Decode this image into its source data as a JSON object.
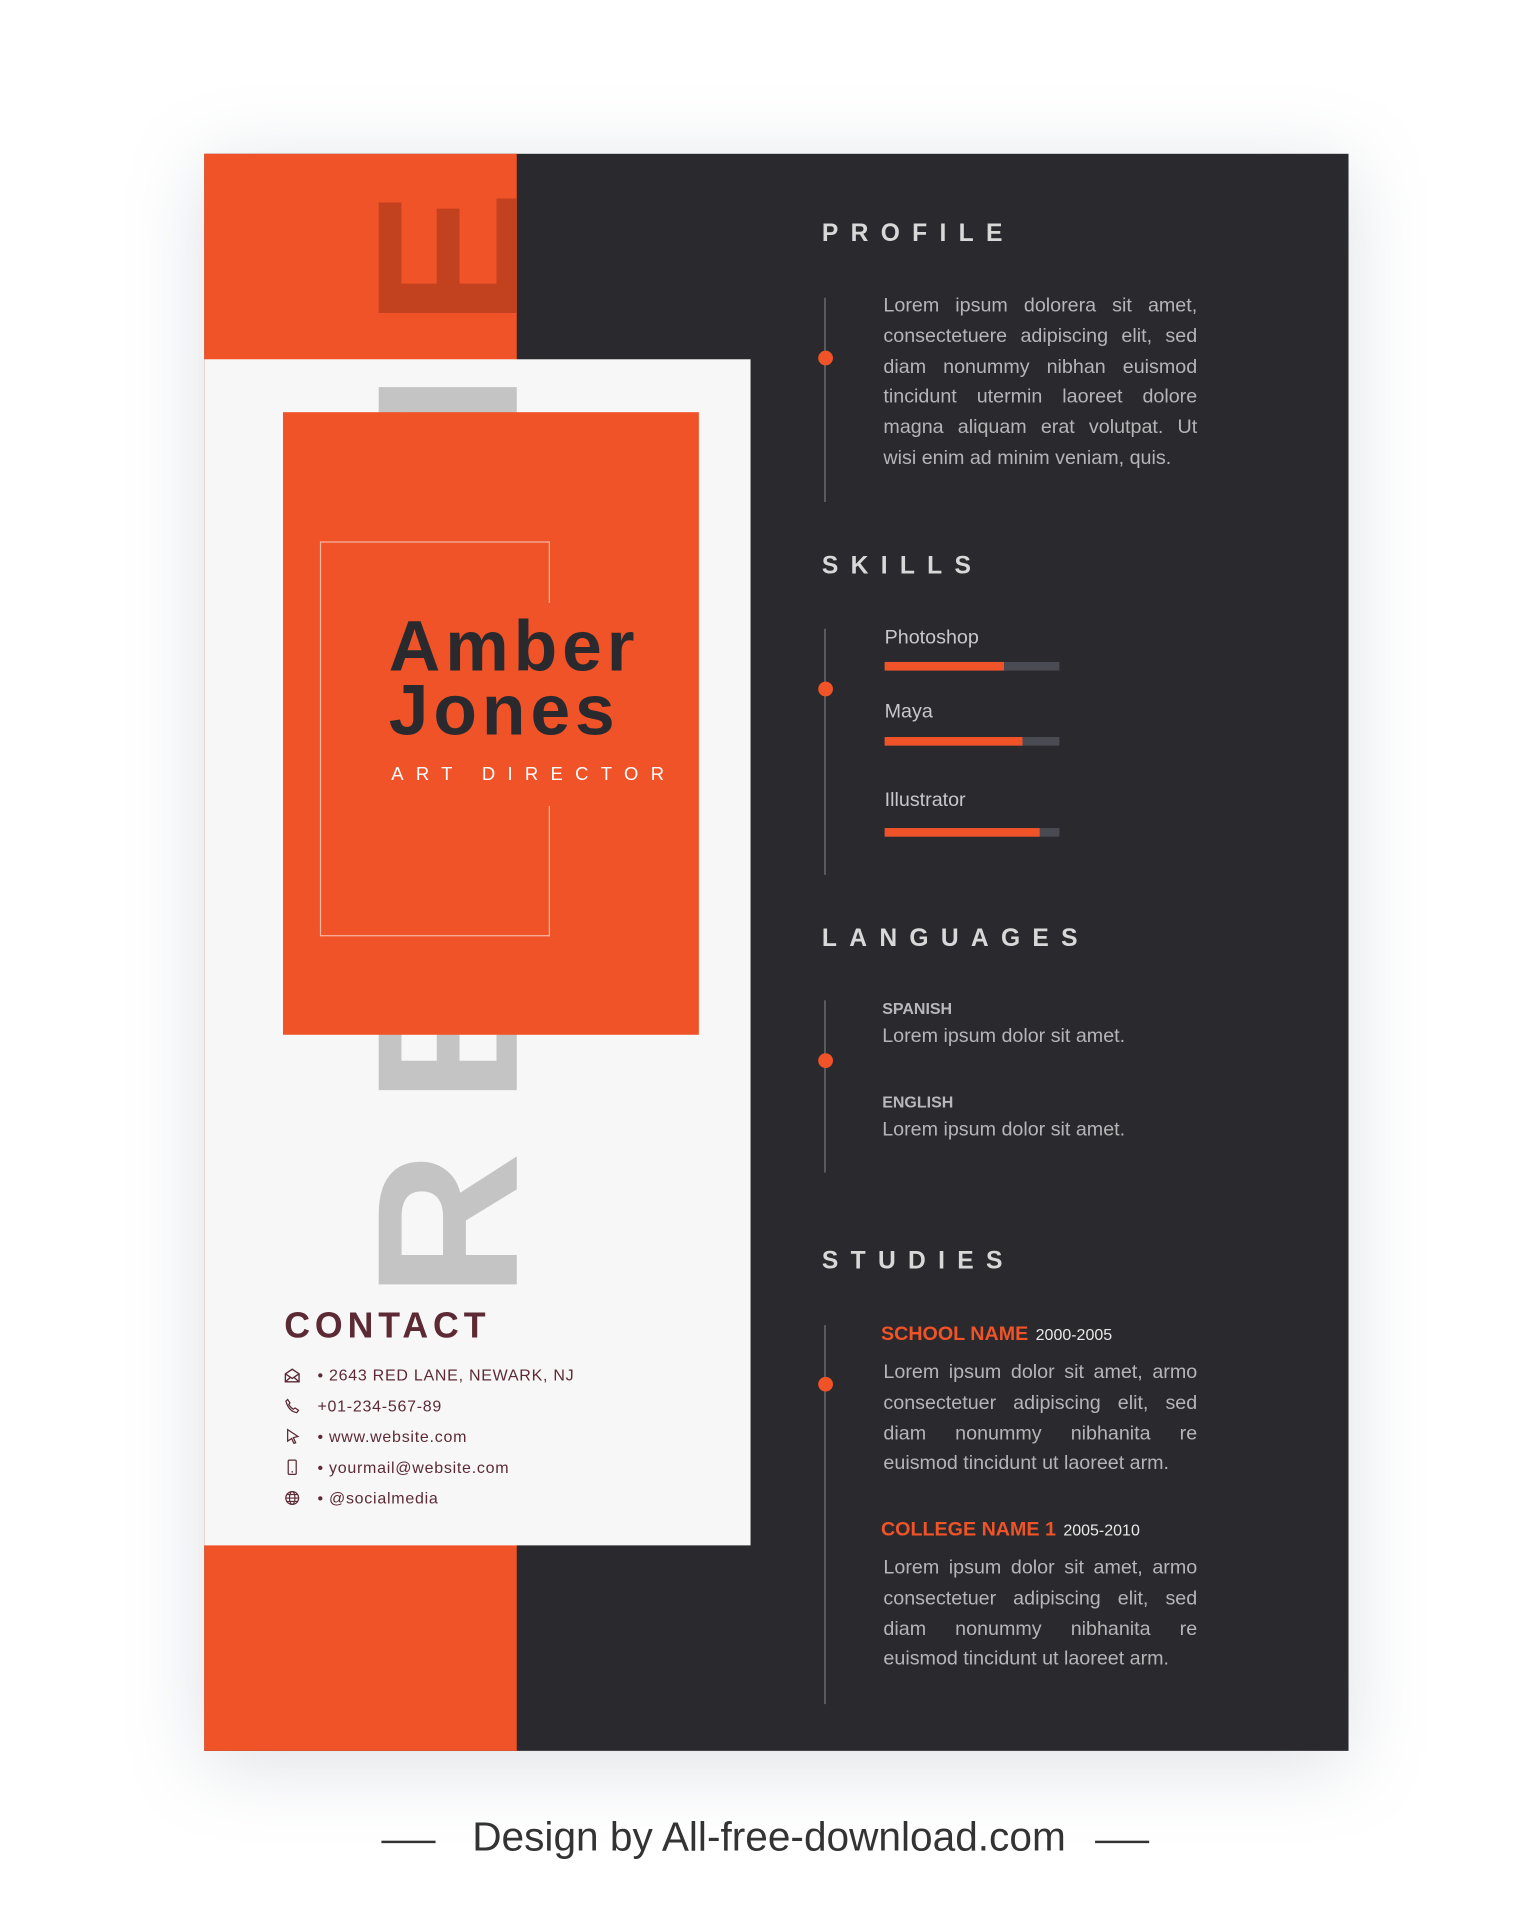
{
  "colors": {
    "accent": "#f05327",
    "dark": "#2a2a2e",
    "panel": "#f7f7f7",
    "contact": "#5c2a35"
  },
  "watermark_word": "RESUME",
  "name": {
    "first": "Amber",
    "last": "Jones",
    "title": "ART DIRECTOR"
  },
  "contact": {
    "heading": "CONTACT",
    "items": [
      {
        "icon": "envelope-icon",
        "text": "• 2643 RED LANE, NEWARK, NJ"
      },
      {
        "icon": "phone-icon",
        "text": "+01-234-567-89"
      },
      {
        "icon": "cursor-icon",
        "text": "• www.website.com"
      },
      {
        "icon": "mobile-icon",
        "text": "• yourmail@website.com"
      },
      {
        "icon": "globe-icon",
        "text": "• @socialmedia"
      }
    ]
  },
  "profile": {
    "heading": "PROFILE",
    "text": "Lorem ipsum dolorera sit amet, consectetuere adipiscing elit, sed diam nonummy nibhan euismod tincidunt utermin laoreet dolore magna aliquam erat volutpat. Ut wisi enim ad minim veniam, quis."
  },
  "skills": {
    "heading": "SKILLS",
    "items": [
      {
        "name": "Photoshop",
        "level": 0.68
      },
      {
        "name": "Maya",
        "level": 0.79
      },
      {
        "name": "Illustrator",
        "level": 0.89
      }
    ]
  },
  "languages": {
    "heading": "LANGUAGES",
    "items": [
      {
        "name": "SPANISH",
        "text": "Lorem ipsum dolor sit amet."
      },
      {
        "name": "ENGLISH",
        "text": "Lorem ipsum dolor sit amet."
      }
    ]
  },
  "studies": {
    "heading": "STUDIES",
    "items": [
      {
        "name": "SCHOOL NAME",
        "years": "2000-2005",
        "text": "Lorem ipsum dolor sit amet, armo consectetuer adipiscing elit, sed diam nonummy nibhanita re euismod tincidunt ut laoreet arm."
      },
      {
        "name": "COLLEGE NAME 1",
        "years": "2005-2010",
        "text": "Lorem ipsum dolor sit amet, armo consectetuer adipiscing elit, sed diam nonummy nibhanita re euismod tincidunt ut laoreet arm."
      }
    ]
  },
  "footer": "Design by All-free-download.com"
}
